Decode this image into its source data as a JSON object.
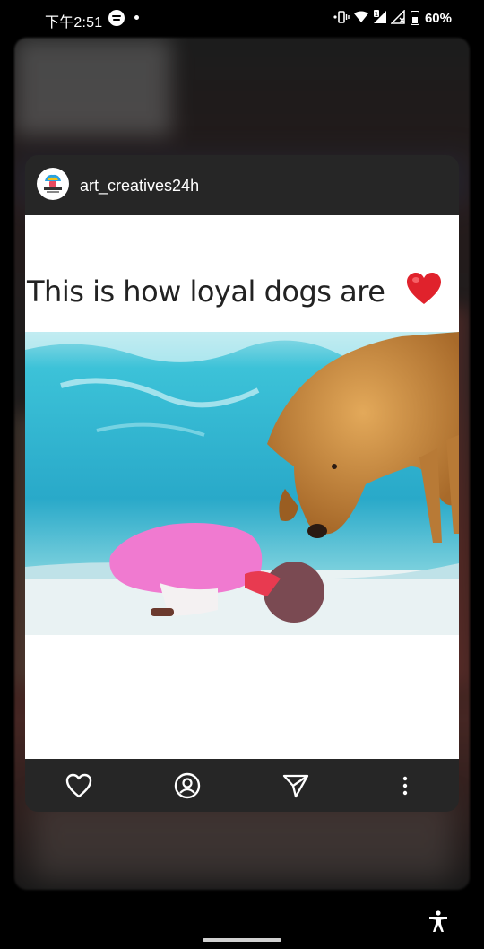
{
  "status_bar": {
    "time": "下午2:51",
    "battery": "60%",
    "icons": [
      "spotify-icon",
      "notification-dot",
      "vibrate-icon",
      "wifi-icon",
      "signal-icon",
      "signal-x-icon",
      "battery-icon"
    ]
  },
  "post": {
    "username": "art_creatives24h",
    "caption": "This is how loyal dogs are",
    "caption_emoji": "red-heart-emoji",
    "media_description_icon": "video-frame"
  },
  "footer_actions": [
    {
      "name": "like",
      "icon": "heart-outline-icon"
    },
    {
      "name": "profile",
      "icon": "profile-icon"
    },
    {
      "name": "share",
      "icon": "send-icon"
    },
    {
      "name": "more",
      "icon": "more-vertical-icon"
    }
  ],
  "colors": {
    "card_bg": "#262626",
    "media_bg": "#ffffff",
    "water": "#37c0d6",
    "dog": "#c98a3e",
    "heart": "#e0222c"
  }
}
